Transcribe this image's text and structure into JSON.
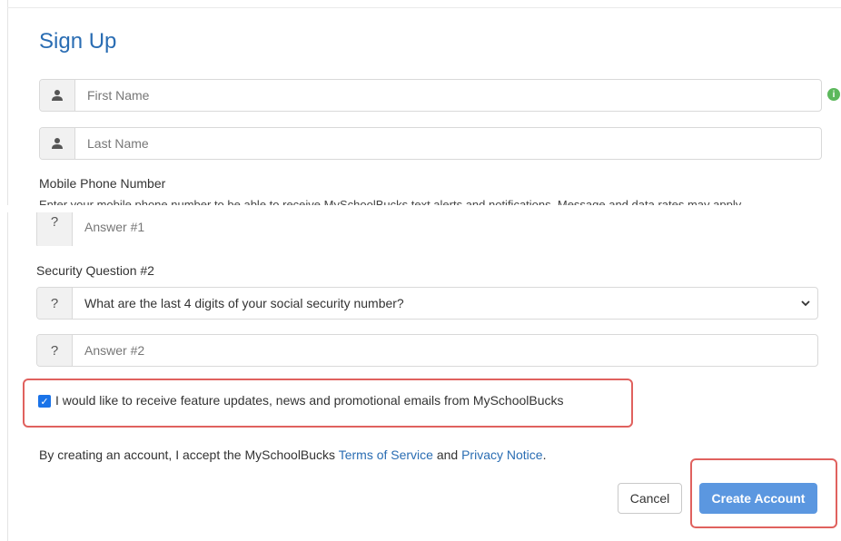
{
  "form": {
    "title": "Sign Up",
    "first_name_placeholder": "First Name",
    "last_name_placeholder": "Last Name",
    "mobile_label": "Mobile Phone Number",
    "mobile_help_cut": "Enter your mobile phone number to be able to receive MySchoolBucks text alerts and notifications. Message and data rates may apply.",
    "answer1_placeholder": "Answer #1",
    "security_q2_label": "Security Question #2",
    "security_q2_value": "What are the last 4 digits of your social security number?",
    "answer2_placeholder": "Answer #2",
    "optin_label": "I would like to receive feature updates, news and promotional emails from MySchoolBucks",
    "optin_checked": true,
    "terms_prefix": "By creating an account, I accept the MySchoolBucks",
    "terms_link": "Terms of Service",
    "terms_and": "and",
    "privacy_link": "Privacy Notice",
    "terms_suffix": ".",
    "cancel_label": "Cancel",
    "create_label": "Create Account"
  },
  "icons": {
    "person": "person-icon",
    "question": "question-icon",
    "info": "info-icon",
    "chevron": "chevron-down-icon"
  },
  "colors": {
    "title": "#2a6db3",
    "link": "#2a6db3",
    "primary_button": "#5b97e0",
    "highlight": "#e0615e",
    "info": "#5cb85c"
  }
}
